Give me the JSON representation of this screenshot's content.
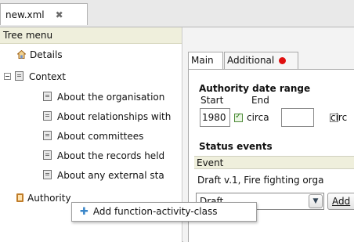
{
  "file_tab": {
    "label": "new.xml",
    "close_glyph": "✖"
  },
  "tree": {
    "header": "Tree menu",
    "items": [
      {
        "label": "Details",
        "icon": "house-icon"
      },
      {
        "label": "Context",
        "icon": "document-icon"
      },
      {
        "label": "About the organisation",
        "icon": "document-icon"
      },
      {
        "label": "About relationships with",
        "icon": "document-icon"
      },
      {
        "label": "About committees",
        "icon": "document-icon"
      },
      {
        "label": "About the records held",
        "icon": "document-icon"
      },
      {
        "label": "About any external sta",
        "icon": "document-icon"
      },
      {
        "label": "Authority",
        "icon": "clipboard-icon"
      }
    ]
  },
  "context_menu": {
    "item": "Add function-activity-class"
  },
  "right_panel": {
    "tabs": [
      {
        "label": "Main"
      },
      {
        "label": "Additional"
      }
    ],
    "date_range": {
      "title": "Authority date range",
      "start_label": "Start",
      "end_label": "End",
      "start_value": "1980",
      "start_circa_checked": true,
      "circa_label": "circa",
      "end_value": "",
      "end_circa_label": "circ",
      "end_circa_checked": false
    },
    "status_events": {
      "title": "Status events",
      "column": "Event",
      "row_text": "Draft v.1, Fire fighting orga",
      "select_value": "Draft",
      "add_button": "Add"
    }
  },
  "colors": {
    "tree_header_bg": "#efefdc",
    "alert_dot": "#e01010",
    "checkbox_check": "#2e7d19"
  }
}
